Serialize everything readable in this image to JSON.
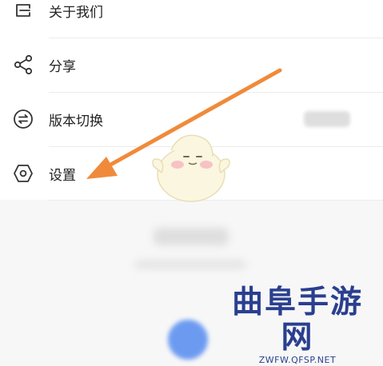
{
  "menu": {
    "items": [
      {
        "label": "关于我们",
        "icon": "book-icon"
      },
      {
        "label": "分享",
        "icon": "share-icon"
      },
      {
        "label": "版本切换",
        "icon": "switch-icon"
      },
      {
        "label": "设置",
        "icon": "settings-hexagon-icon"
      }
    ]
  },
  "watermark": {
    "title": "曲阜手游网",
    "url": "ZWFW.QFSP.NET"
  },
  "colors": {
    "arrow": "#f08a3a",
    "watermark": "#2a3f8f",
    "divider": "#ececec"
  }
}
